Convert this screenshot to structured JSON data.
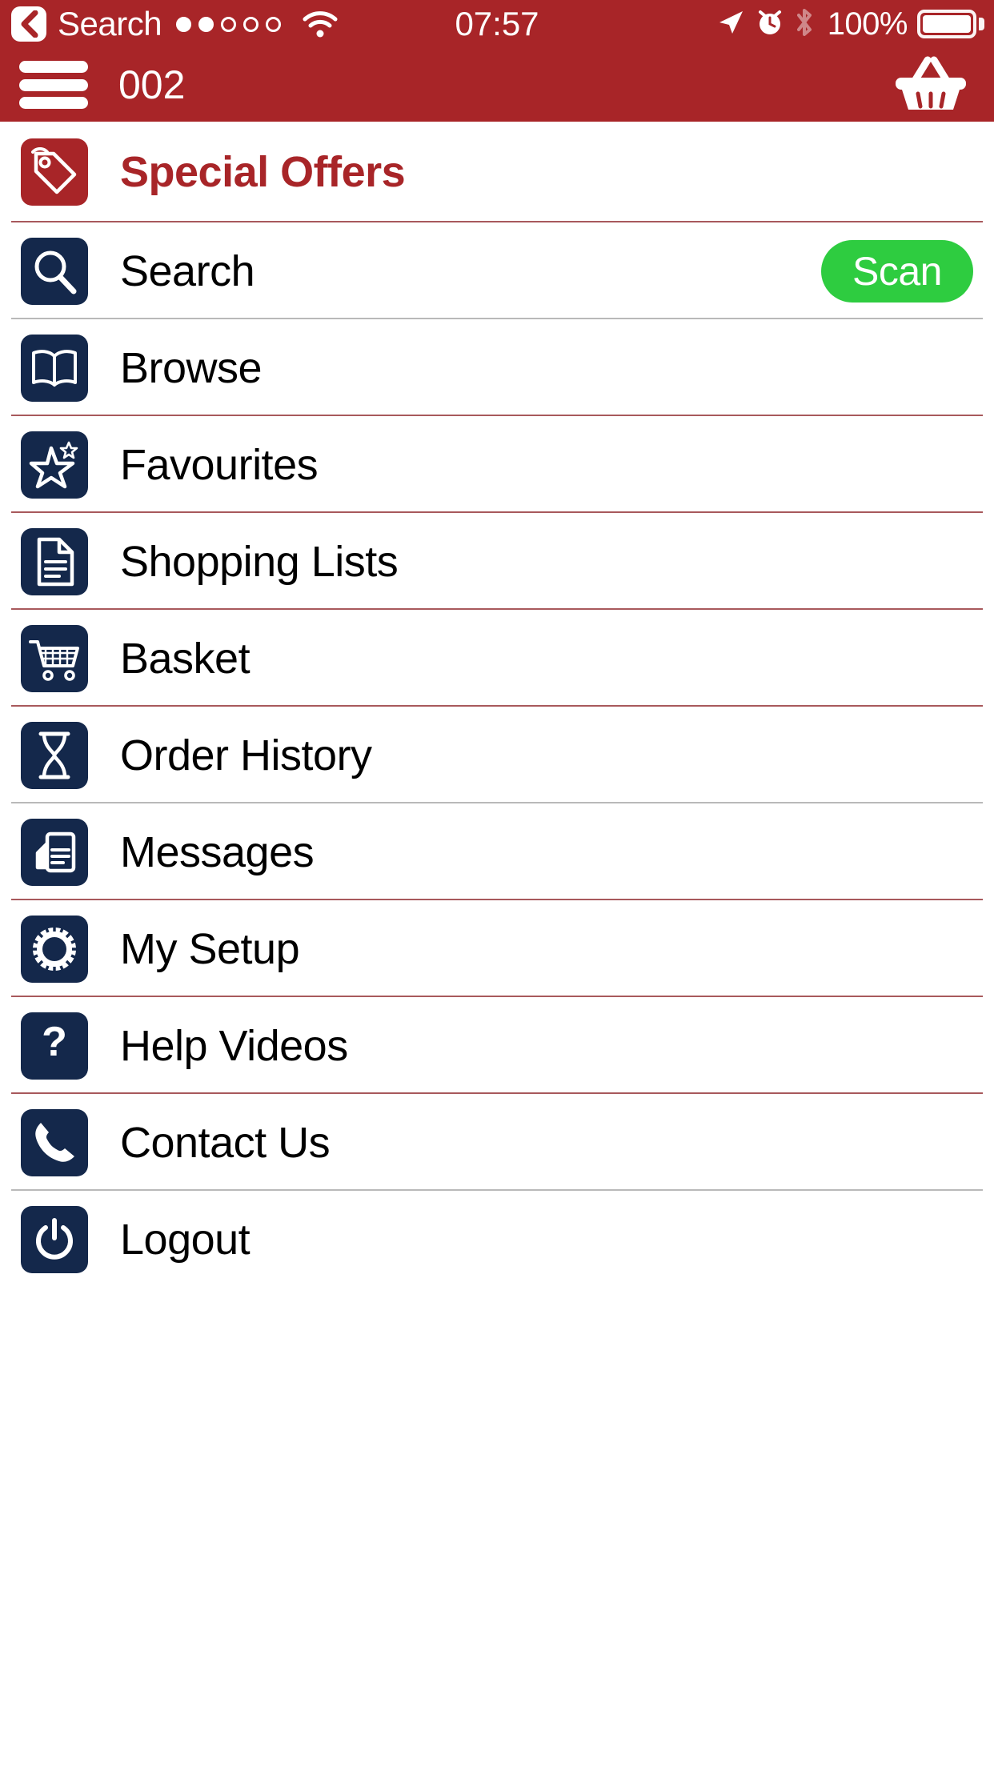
{
  "status_bar": {
    "back_label": "Search",
    "back_icon": "chevron-left-icon",
    "signal_dots_total": 5,
    "signal_dots_filled": 2,
    "wifi_icon": "wifi-icon",
    "time": "07:57",
    "location_icon": "location-arrow-icon",
    "alarm_icon": "alarm-clock-icon",
    "bluetooth_icon": "bluetooth-icon",
    "battery_percent": "100%",
    "battery_level": 100
  },
  "nav_bar": {
    "menu_icon": "hamburger-menu-icon",
    "title": "002",
    "basket_icon": "shopping-basket-icon"
  },
  "colors": {
    "brand_red": "#a82528",
    "icon_navy": "#14284b",
    "scan_green": "#2ecc40",
    "separator_red": "#8b2226",
    "text_black": "#000000",
    "white": "#ffffff"
  },
  "menu": {
    "items": [
      {
        "label": "Special Offers",
        "icon": "price-tag-icon",
        "style": "offers"
      },
      {
        "label": "Search",
        "icon": "magnifier-icon",
        "style": "normal",
        "action_label": "Scan"
      },
      {
        "label": "Browse",
        "icon": "open-book-icon",
        "style": "normal"
      },
      {
        "label": "Favourites",
        "icon": "star-icon",
        "style": "normal"
      },
      {
        "label": "Shopping Lists",
        "icon": "document-lines-icon",
        "style": "normal"
      },
      {
        "label": "Basket",
        "icon": "shopping-cart-icon",
        "style": "normal"
      },
      {
        "label": "Order History",
        "icon": "hourglass-icon",
        "style": "normal"
      },
      {
        "label": "Messages",
        "icon": "message-document-icon",
        "style": "normal"
      },
      {
        "label": "My Setup",
        "icon": "gear-icon",
        "style": "normal"
      },
      {
        "label": "Help Videos",
        "icon": "question-mark-icon",
        "style": "normal"
      },
      {
        "label": "Contact Us",
        "icon": "telephone-icon",
        "style": "normal"
      },
      {
        "label": "Logout",
        "icon": "power-icon",
        "style": "normal"
      }
    ]
  }
}
